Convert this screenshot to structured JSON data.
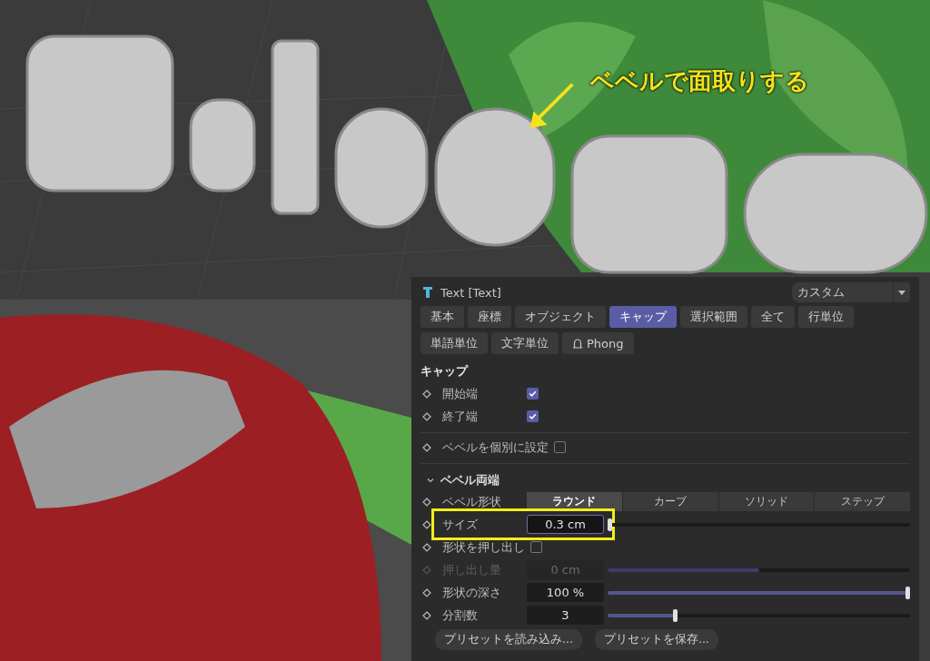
{
  "annotation": {
    "text": "ベベルで面取りする"
  },
  "panel": {
    "title": "Text [Text]",
    "preset": "カスタム",
    "tabs": [
      {
        "label": "基本",
        "selected": false,
        "kind": "plain"
      },
      {
        "label": "座標",
        "selected": false,
        "kind": "plain"
      },
      {
        "label": "オブジェクト",
        "selected": false,
        "kind": "plain"
      },
      {
        "label": "キャップ",
        "selected": true,
        "kind": "plain"
      },
      {
        "label": "選択範囲",
        "selected": false,
        "kind": "plain"
      },
      {
        "label": "全て",
        "selected": false,
        "kind": "plain"
      },
      {
        "label": "行単位",
        "selected": false,
        "kind": "plain"
      },
      {
        "label": "単語単位",
        "selected": false,
        "kind": "plain"
      },
      {
        "label": "文字単位",
        "selected": false,
        "kind": "plain"
      },
      {
        "label": "Phong",
        "selected": false,
        "kind": "phong"
      }
    ],
    "section_title": "キャップ",
    "cap_rows": [
      {
        "label": "開始端",
        "checked": true
      },
      {
        "label": "終了端",
        "checked": true
      }
    ],
    "individual_bevel": {
      "label": "ベベルを個別に設定",
      "checked": false
    },
    "group": {
      "title": "ベベル両端",
      "expanded": true
    },
    "bevel_shape": {
      "label": "ベベル形状",
      "options": [
        {
          "label": "ラウンド",
          "selected": true
        },
        {
          "label": "カーブ",
          "selected": false
        },
        {
          "label": "ソリッド",
          "selected": false
        },
        {
          "label": "ステップ",
          "selected": false
        }
      ]
    },
    "params": [
      {
        "kind": "slider",
        "label": "サイズ",
        "value": "0.3 cm",
        "level": 0.0,
        "disabled": false,
        "highlighted": true,
        "focused": true
      },
      {
        "kind": "checkbox",
        "label": "形状を押し出し",
        "checked": false,
        "disabled": false
      },
      {
        "kind": "slider",
        "label": "押し出し量",
        "value": "0 cm",
        "level": 0.5,
        "disabled": true,
        "highlighted": false,
        "focused": false
      },
      {
        "kind": "slider",
        "label": "形状の深さ",
        "value": "100 %",
        "level": 1.0,
        "disabled": false,
        "highlighted": false,
        "focused": false
      },
      {
        "kind": "slider",
        "label": "分割数",
        "value": "3",
        "level": 0.22,
        "disabled": false,
        "highlighted": false,
        "focused": false
      }
    ],
    "buttons": [
      "プリセットを読み込み...",
      "プリセットを保存..."
    ]
  }
}
